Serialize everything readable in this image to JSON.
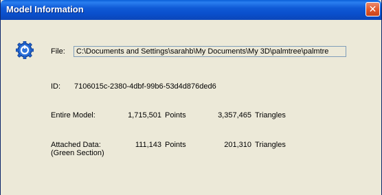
{
  "window": {
    "title": "Model Information",
    "close_label": "✕"
  },
  "file": {
    "label": "File:",
    "value": "C:\\Documents and Settings\\sarahb\\My Documents\\My 3D\\palmtree\\palmtre"
  },
  "id": {
    "label": "ID:",
    "value": "7106015c-2380-4dbf-99b6-53d4d876ded6"
  },
  "entire_model": {
    "label": "Entire Model:",
    "points": "1,715,501",
    "points_unit": "Points",
    "triangles": "3,357,465",
    "triangles_unit": "Triangles"
  },
  "attached_data": {
    "label_line1": "Attached Data:",
    "label_line2": "(Green Section)",
    "points": "111,143",
    "points_unit": "Points",
    "triangles": "201,310",
    "triangles_unit": "Triangles"
  },
  "icons": {
    "app": "gear-icon",
    "close": "close-icon"
  },
  "colors": {
    "titlebar": "#0a4fcc",
    "close_button": "#e25a2c",
    "dialog_background": "#ece9d8",
    "gear_icon": "#1f5fc9"
  }
}
